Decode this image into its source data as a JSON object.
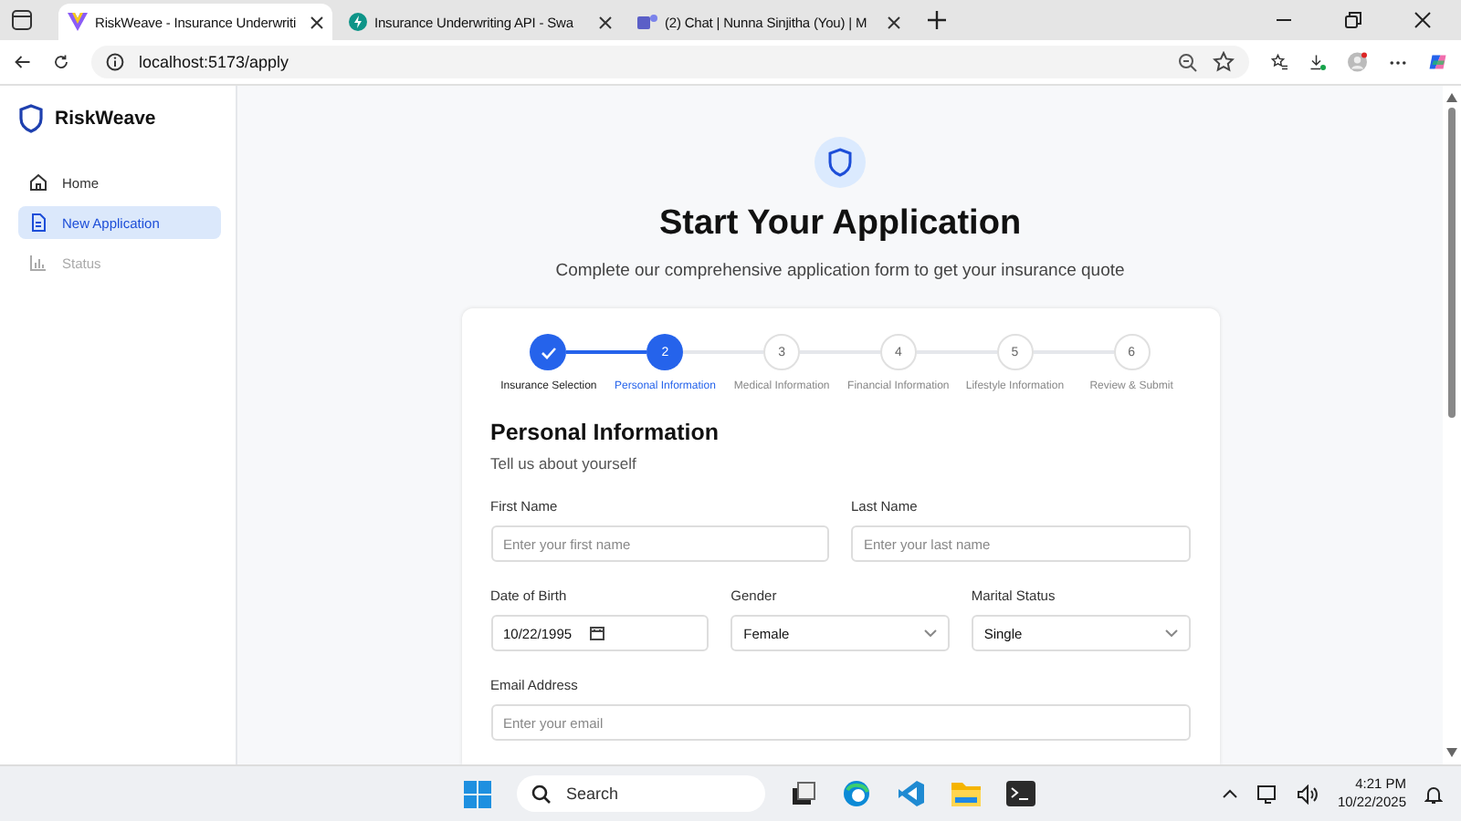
{
  "browser": {
    "tabs": [
      {
        "title": "RiskWeave - Insurance Underwriti",
        "selected": true
      },
      {
        "title": "Insurance Underwriting API - Swa",
        "selected": false
      },
      {
        "title": "(2) Chat | Nunna Sinjitha (You) | M",
        "selected": false
      }
    ],
    "address": "localhost:5173/apply"
  },
  "sidebar": {
    "brand": "RiskWeave",
    "items": [
      {
        "label": "Home",
        "selected": false,
        "disabled": false
      },
      {
        "label": "New Application",
        "selected": true,
        "disabled": false
      },
      {
        "label": "Status",
        "selected": false,
        "disabled": true
      }
    ]
  },
  "header": {
    "title": "Start Your Application",
    "subtitle": "Complete our comprehensive application form to get your insurance quote"
  },
  "steps": [
    {
      "label": "Insurance Selection",
      "complete": true,
      "selected": false
    },
    {
      "number": "2",
      "label": "Personal Information",
      "complete": false,
      "selected": true
    },
    {
      "number": "3",
      "label": "Medical Information",
      "complete": false,
      "selected": false
    },
    {
      "number": "4",
      "label": "Financial Information",
      "complete": false,
      "selected": false
    },
    {
      "number": "5",
      "label": "Lifestyle Information",
      "complete": false,
      "selected": false
    },
    {
      "number": "6",
      "label": "Review & Submit",
      "complete": false,
      "selected": false
    }
  ],
  "section": {
    "title": "Personal Information",
    "subtitle": "Tell us about yourself"
  },
  "rows": [
    [
      {
        "kind": "text",
        "label": "First Name",
        "placeholder": "Enter your first name"
      },
      {
        "kind": "text",
        "label": "Last Name",
        "placeholder": "Enter your last name"
      }
    ],
    [
      {
        "kind": "date",
        "label": "Date of Birth",
        "value": "10/22/1995"
      },
      {
        "kind": "select",
        "label": "Gender",
        "value": "Female"
      },
      {
        "kind": "select",
        "label": "Marital Status",
        "value": "Single"
      }
    ],
    [
      {
        "kind": "text",
        "label": "Email Address",
        "placeholder": "Enter your email"
      }
    ]
  ],
  "taskbar": {
    "search": "Search",
    "time": "4:21 PM",
    "date": "10/22/2025"
  }
}
